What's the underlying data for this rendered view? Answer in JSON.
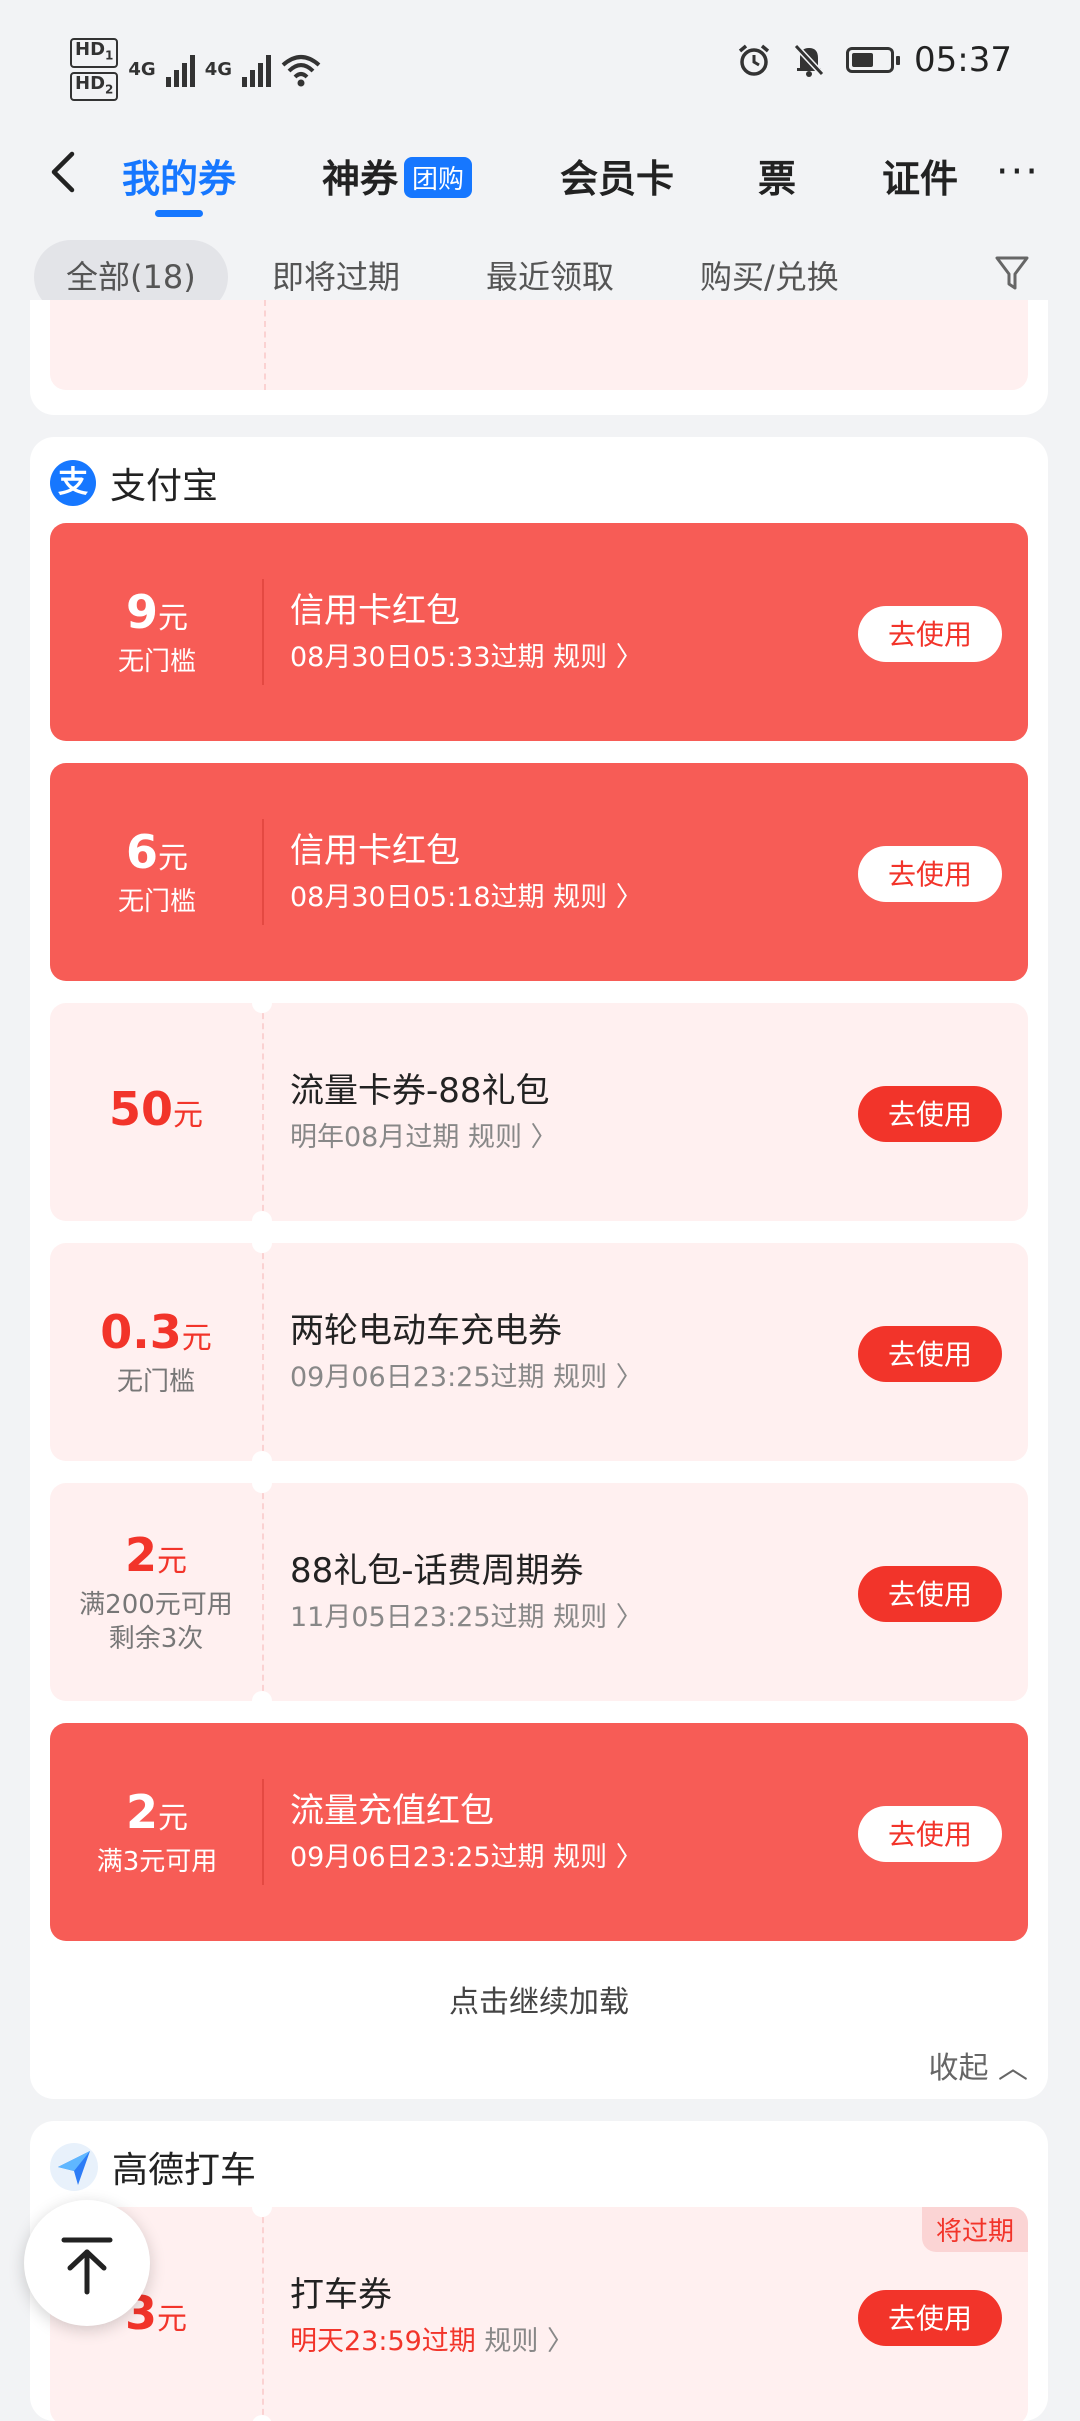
{
  "status_bar": {
    "hd1": "HD",
    "hd1_sub": "1",
    "hd2": "HD",
    "hd2_sub": "2",
    "net1": "4G",
    "net2": "4G",
    "time": "05:37"
  },
  "nav": {
    "tabs": [
      {
        "label": "我的券"
      },
      {
        "label": "神券",
        "badge": "团购"
      },
      {
        "label": "会员卡"
      },
      {
        "label": "票"
      },
      {
        "label": "证件"
      }
    ],
    "more": "···"
  },
  "filters": [
    {
      "label": "全部(18)"
    },
    {
      "label": "即将过期"
    },
    {
      "label": "最近领取"
    },
    {
      "label": "购买/兑换"
    }
  ],
  "alipay": {
    "title": "支付宝",
    "icon_char": "支",
    "coupons": [
      {
        "amount": "9",
        "unit": "元",
        "cond": "无门槛",
        "title": "信用卡红包",
        "expire": "08月30日05:33过期",
        "rule": "规则",
        "button": "去使用",
        "style": "red"
      },
      {
        "amount": "6",
        "unit": "元",
        "cond": "无门槛",
        "title": "信用卡红包",
        "expire": "08月30日05:18过期",
        "rule": "规则",
        "button": "去使用",
        "style": "red"
      },
      {
        "amount": "50",
        "unit": "元",
        "cond": "",
        "title": "流量卡券-88礼包",
        "expire": "明年08月过期",
        "rule": "规则",
        "button": "去使用",
        "style": "pink"
      },
      {
        "amount": "0.3",
        "unit": "元",
        "cond": "无门槛",
        "title": "两轮电动车充电券",
        "expire": "09月06日23:25过期",
        "rule": "规则",
        "button": "去使用",
        "style": "pink"
      },
      {
        "amount": "2",
        "unit": "元",
        "cond": "满200元可用",
        "cond2": "剩余3次",
        "title": "88礼包-话费周期券",
        "expire": "11月05日23:25过期",
        "rule": "规则",
        "button": "去使用",
        "style": "pink"
      },
      {
        "amount": "2",
        "unit": "元",
        "cond": "满3元可用",
        "title": "流量充值红包",
        "expire": "09月06日23:25过期",
        "rule": "规则",
        "button": "去使用",
        "style": "red"
      }
    ],
    "load_more": "点击继续加载",
    "collapse": "收起"
  },
  "amap": {
    "title": "高德打车",
    "coupon": {
      "amount": "3",
      "unit": "元",
      "tag": "将过期",
      "title": "打车券",
      "expire": "明天23:59过期",
      "rule": "规则",
      "button": "去使用"
    }
  },
  "colors": {
    "accent": "#1677ff",
    "coupon_red": "#f75c56",
    "button_red": "#f2342a"
  }
}
